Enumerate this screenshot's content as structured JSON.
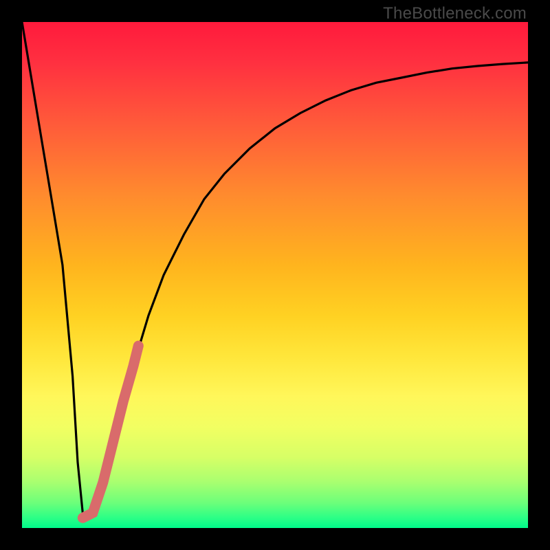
{
  "watermark": "TheBottleneck.com",
  "chart_data": {
    "type": "line",
    "title": "",
    "xlabel": "",
    "ylabel": "",
    "xlim": [
      0,
      100
    ],
    "ylim": [
      0,
      100
    ],
    "series": [
      {
        "name": "bottleneck-curve",
        "x": [
          0,
          2,
          4,
          6,
          8,
          10,
          11,
          12,
          13,
          14,
          16,
          18,
          20,
          22,
          25,
          28,
          32,
          36,
          40,
          45,
          50,
          55,
          60,
          65,
          70,
          75,
          80,
          85,
          90,
          95,
          100
        ],
        "y": [
          100,
          88,
          76,
          64,
          52,
          30,
          13,
          3,
          2,
          3,
          9,
          17,
          25,
          32,
          42,
          50,
          58,
          65,
          70,
          75,
          79,
          82,
          84.5,
          86.5,
          88,
          89,
          90,
          90.8,
          91.3,
          91.7,
          92
        ]
      },
      {
        "name": "highlight-segment",
        "x": [
          12,
          14,
          16,
          18,
          20,
          22,
          23
        ],
        "y": [
          2,
          3,
          9,
          17,
          25,
          32,
          36
        ]
      }
    ],
    "gradient_stops": [
      {
        "pos": 0,
        "color": "#ff1a3c"
      },
      {
        "pos": 50,
        "color": "#ffd122"
      },
      {
        "pos": 80,
        "color": "#f2ff62"
      },
      {
        "pos": 100,
        "color": "#00f98a"
      }
    ]
  }
}
